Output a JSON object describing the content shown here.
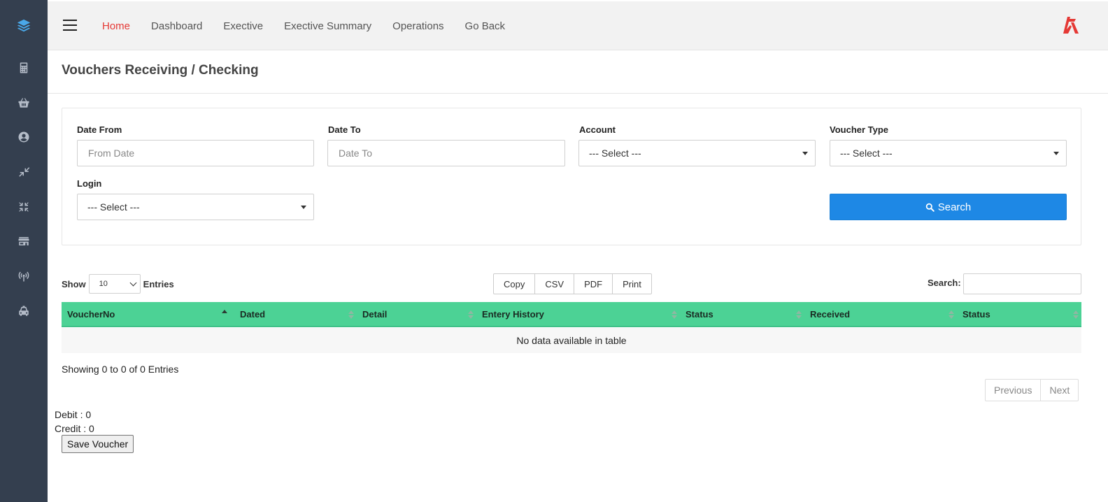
{
  "sidebar": {
    "icons": [
      "layers-icon",
      "calculator-icon",
      "basket-icon",
      "user-circle-icon",
      "compress-icon",
      "collapse-arrows-icon",
      "store-icon",
      "broadcast-icon",
      "car-icon"
    ],
    "icon_color": "#b4bcc8",
    "logo_color": "#4aa8e8",
    "background": "#343f4f"
  },
  "topbar": {
    "nav": [
      "Home",
      "Dashboard",
      "Exective",
      "Exective Summary",
      "Operations",
      "Go Back"
    ],
    "active_color": "#e53935",
    "brand_color": "#e53935"
  },
  "page": {
    "title": "Vouchers Receiving / Checking"
  },
  "filters": {
    "date_from": {
      "label": "Date From",
      "placeholder": "From Date"
    },
    "date_to": {
      "label": "Date To",
      "placeholder": "Date To"
    },
    "account": {
      "label": "Account",
      "value": "--- Select ---"
    },
    "voucher_type": {
      "label": "Voucher Type",
      "value": "--- Select ---"
    },
    "login": {
      "label": "Login",
      "value": "--- Select ---"
    },
    "search_button": "Search",
    "button_color": "#1e88e5"
  },
  "table_controls": {
    "show": "Show",
    "page_length": "10",
    "entries": "Entries",
    "export_buttons": [
      "Copy",
      "CSV",
      "PDF",
      "Print"
    ],
    "search_label": "Search:"
  },
  "table": {
    "header_color": "#4cd295",
    "columns": [
      "VoucherNo",
      "Dated",
      "Detail",
      "Entery History",
      "Status",
      "Received",
      "Status"
    ],
    "empty_message": "No data available in table"
  },
  "footer": {
    "info": "Showing 0 to 0 of 0 Entries",
    "previous": "Previous",
    "next": "Next",
    "debit": "Debit : 0",
    "credit": "Credit : 0",
    "save_button": "Save Voucher"
  }
}
